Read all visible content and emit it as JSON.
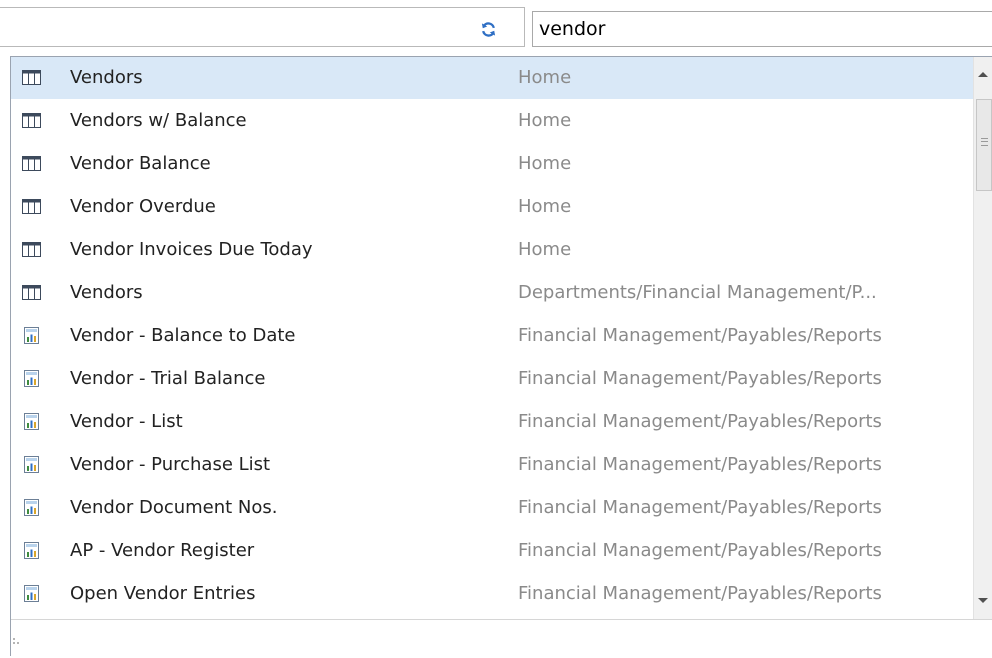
{
  "search": {
    "value": "vendor"
  },
  "icons": {
    "refresh": "refresh-icon",
    "page": "table-page-icon",
    "report": "report-icon"
  },
  "colors": {
    "selected_row": "#d9e8f7",
    "refresh_blue": "#2f6fc4",
    "path_text": "#8a8a8a"
  },
  "results": [
    {
      "name": "Vendors",
      "path": "Home",
      "type": "page",
      "selected": true
    },
    {
      "name": "Vendors w/ Balance",
      "path": "Home",
      "type": "page"
    },
    {
      "name": "Vendor Balance",
      "path": "Home",
      "type": "page"
    },
    {
      "name": "Vendor Overdue",
      "path": "Home",
      "type": "page"
    },
    {
      "name": "Vendor Invoices Due Today",
      "path": "Home",
      "type": "page"
    },
    {
      "name": "Vendors",
      "path": "Departments/Financial Management/P...",
      "type": "page"
    },
    {
      "name": "Vendor - Balance to Date",
      "path": "Financial Management/Payables/Reports",
      "type": "report"
    },
    {
      "name": "Vendor - Trial Balance",
      "path": "Financial Management/Payables/Reports",
      "type": "report"
    },
    {
      "name": "Vendor - List",
      "path": "Financial Management/Payables/Reports",
      "type": "report"
    },
    {
      "name": "Vendor - Purchase List",
      "path": "Financial Management/Payables/Reports",
      "type": "report"
    },
    {
      "name": "Vendor Document Nos.",
      "path": "Financial Management/Payables/Reports",
      "type": "report"
    },
    {
      "name": "AP - Vendor Register",
      "path": "Financial Management/Payables/Reports",
      "type": "report"
    },
    {
      "name": "Open Vendor Entries",
      "path": "Financial Management/Payables/Reports",
      "type": "report"
    }
  ]
}
